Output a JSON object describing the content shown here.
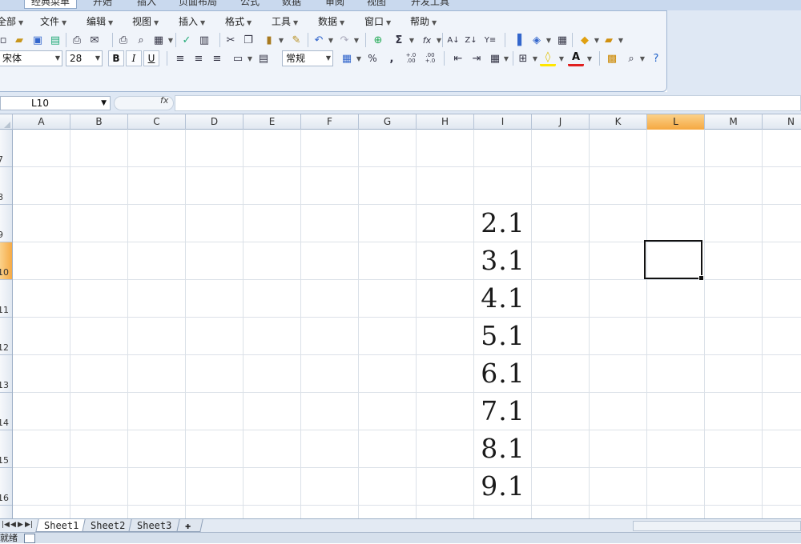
{
  "ribbon_tabs": [
    "经典菜单",
    "开始",
    "插入",
    "页面布局",
    "公式",
    "数据",
    "审阅",
    "视图",
    "开发工具"
  ],
  "menus": [
    {
      "label": "全部"
    },
    {
      "label": "文件"
    },
    {
      "label": "编辑"
    },
    {
      "label": "视图"
    },
    {
      "label": "插入"
    },
    {
      "label": "格式"
    },
    {
      "label": "工具"
    },
    {
      "label": "数据"
    },
    {
      "label": "窗口"
    },
    {
      "label": "帮助"
    }
  ],
  "formatting": {
    "font_name": "宋体",
    "font_size": "28",
    "bold": "B",
    "italic": "I",
    "underline": "U",
    "number_format": "常规",
    "percent": "%",
    "comma": ",",
    "inc_decimal": "+.0 .00",
    "dec_decimal": ".00 +.0"
  },
  "formula_bar": {
    "name_box": "L10",
    "fx": "fx",
    "formula": ""
  },
  "columns": [
    "A",
    "B",
    "C",
    "D",
    "E",
    "F",
    "G",
    "H",
    "I",
    "J",
    "K",
    "L",
    "M",
    "N"
  ],
  "selected_column": "L",
  "rows": [
    "7",
    "8",
    "9",
    "10",
    "11",
    "12",
    "13",
    "14",
    "15",
    "16"
  ],
  "selected_row": "10",
  "cells": {
    "column": "I",
    "values": [
      "2.1",
      "3.1",
      "4.1",
      "5.1",
      "6.1",
      "7.1",
      "8.1",
      "9.1"
    ]
  },
  "sheets": [
    "Sheet1",
    "Sheet2",
    "Sheet3"
  ],
  "active_sheet": "Sheet1",
  "status": {
    "text": "就绪"
  },
  "colors": {
    "selection_header": "#f5a840",
    "ribbon_bg": "#f0f4fa"
  }
}
